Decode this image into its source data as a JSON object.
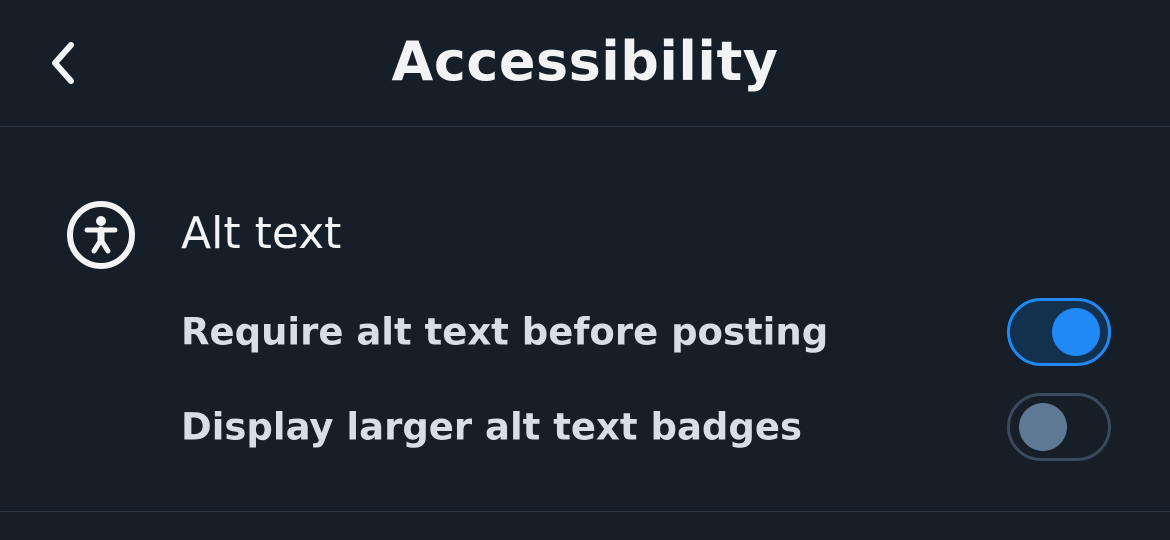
{
  "header": {
    "title": "Accessibility",
    "back_icon": "chevron-left-icon"
  },
  "sections": [
    {
      "icon": "accessibility-person-icon",
      "title": "Alt text",
      "settings": [
        {
          "label": "Require alt text before posting",
          "enabled": true
        },
        {
          "label": "Display larger alt text badges",
          "enabled": false
        }
      ]
    }
  ],
  "colors": {
    "background": "#161e27",
    "accent": "#2189f6",
    "toggle_off_knob": "#5f7894",
    "divider": "#2a3744"
  }
}
